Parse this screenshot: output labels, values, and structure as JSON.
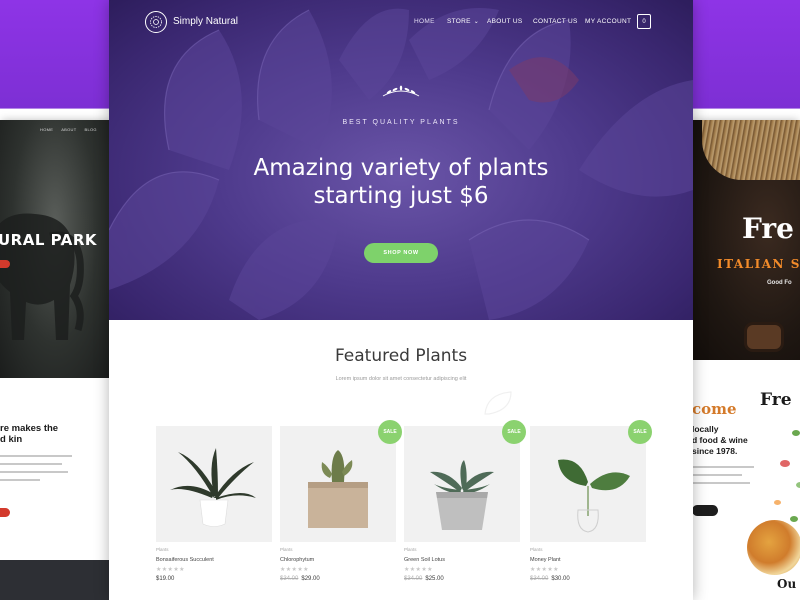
{
  "left_page": {
    "nav": [
      "HOME",
      "ABOUT",
      "BLOG"
    ],
    "hero_title": "URAL PARK",
    "heading_lines": [
      "re makes the",
      "d kin"
    ]
  },
  "right_page": {
    "title": "Fre",
    "subtitle": "ITALIAN S",
    "tagline": "Good Fo",
    "side_title": "Fre",
    "welcome": "come",
    "body_lines": [
      "locally",
      "d food & wine",
      "since 1978."
    ],
    "bottom_text": "Ou"
  },
  "main_page": {
    "brand": "Simply Natural",
    "nav": {
      "home": "HOME",
      "store": "STORE",
      "about": "ABOUT US",
      "contact": "CONTACT US",
      "account": "MY ACCOUNT"
    },
    "cart_count": "0",
    "hero": {
      "eyebrow": "BEST QUALITY PLANTS",
      "title_line1": "Amazing variety of plants",
      "title_line2": "starting just $6",
      "button": "SHOP NOW"
    },
    "section": {
      "title": "Featured Plants",
      "subtitle": "Lorem ipsum dolor sit amet consectetur adipiscing elit"
    },
    "products": [
      {
        "category": "Plants",
        "name": "Bonsaiferous Succulent",
        "stars": "★★★★★",
        "old_price": "",
        "price": "$19.00",
        "badge": ""
      },
      {
        "category": "Plants",
        "name": "Chlorophytum",
        "stars": "★★★★★",
        "old_price": "$34.00",
        "price": "$29.00",
        "badge": "SALE"
      },
      {
        "category": "Plants",
        "name": "Green Soil Lotus",
        "stars": "★★★★★",
        "old_price": "$34.00",
        "price": "$25.00",
        "badge": "SALE"
      },
      {
        "category": "Plants",
        "name": "Money Plant",
        "stars": "★★★★★",
        "old_price": "$34.00",
        "price": "$30.00",
        "badge": "SALE"
      }
    ]
  },
  "colors": {
    "background_purple": "#8e34e6",
    "hero_purple": "#4e3a8c",
    "accent_green": "#7ed26b",
    "badge_green": "#8bd26f",
    "left_accent_red": "#d33a2c",
    "right_accent_orange": "#f28b2a"
  },
  "icons": [
    "logo-icon",
    "store-chevron-icon",
    "cart-icon",
    "laurel-icon"
  ]
}
